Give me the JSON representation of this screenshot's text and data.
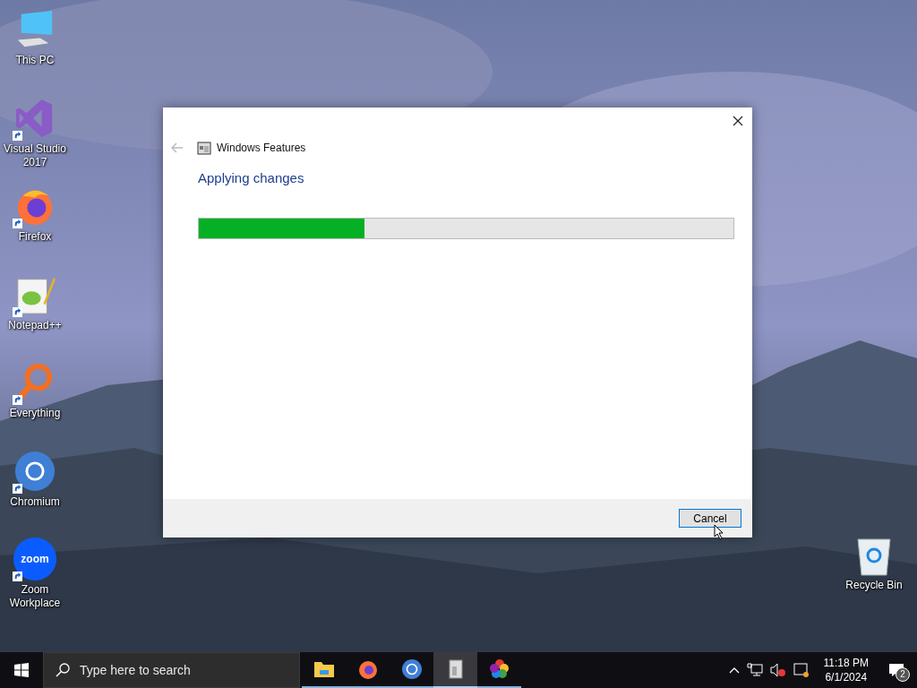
{
  "desktop_icons": [
    {
      "kind": "pc",
      "label": "This PC",
      "shortcut": false
    },
    {
      "kind": "vs",
      "label": "Visual Studio 2017",
      "shortcut": true
    },
    {
      "kind": "firefox",
      "label": "Firefox",
      "shortcut": true
    },
    {
      "kind": "notepad",
      "label": "Notepad++",
      "shortcut": true
    },
    {
      "kind": "everything",
      "label": "Everything",
      "shortcut": true
    },
    {
      "kind": "chromium",
      "label": "Chromium",
      "shortcut": true
    },
    {
      "kind": "zoom",
      "label": "Zoom Workplace",
      "shortcut": true,
      "logo_text": "zoom"
    }
  ],
  "recycle_bin": {
    "label": "Recycle Bin"
  },
  "dialog": {
    "title": "Windows Features",
    "heading": "Applying changes",
    "progress": {
      "level": 0.31
    },
    "buttons": [
      "Cancel"
    ]
  },
  "taskbar": {
    "search": {
      "placeholder": "Type here to search"
    },
    "apps": [
      {
        "kind": "explorer",
        "selected": false
      },
      {
        "kind": "firefox",
        "selected": false
      },
      {
        "kind": "chromium",
        "selected": false
      },
      {
        "kind": "features",
        "selected": true
      },
      {
        "kind": "colors",
        "selected": false
      }
    ],
    "clock": {
      "time": "11:18 PM",
      "date": "6/1/2024"
    },
    "notifications": {
      "count": "2"
    }
  }
}
